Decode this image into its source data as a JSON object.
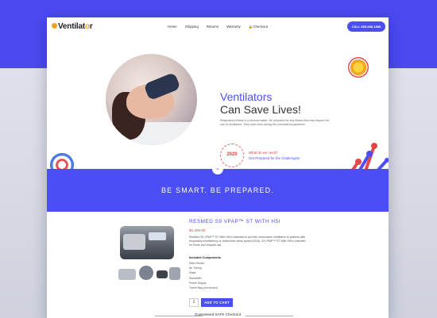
{
  "site": {
    "logo": {
      "prefix": "Ventilat",
      "o": "o",
      "suffix": "r"
    },
    "nav": [
      "Home",
      "Shipping",
      "Returns",
      "Warranty",
      "Checkout"
    ],
    "nav_checkout_icon": "lock-icon",
    "call_button": "CALL 855-688-1888",
    "hero": {
      "title1": "Ventilators",
      "title2": "Can Save Lives!",
      "text": "Respiratory illness is a serious matter. Be prepared for any illness that may require the use of ventilators. They save lives during the coronavirus pandemic.",
      "badge": "2020",
      "question": "What do we need?",
      "link": "Get Prepared for the Challenges!"
    },
    "band": {
      "text": "BE SMART.   BE PREPARED.",
      "chevron": "chevron-down-icon"
    },
    "product": {
      "title": "RESMED S9 VPAP™ ST WITH H5I",
      "price": "$2,400.00",
      "description": "ResMed S9 VPAP™ ST With H5i is intended to provide noninvasive ventilation to patients with respiratory insufficiency or obstructive sleep apnea (OSA). S9 VPAP™ ST With H5i is intended for home and hospital use.",
      "included_heading": "Included Components",
      "included": [
        "Main Device",
        "Air Tubing",
        "Mask",
        "Humidifier",
        "Power Supply",
        "Travel Bag (not shown)"
      ],
      "quantity": "1",
      "add_to_cart": "ADD TO CART",
      "safe_checkout": "Guaranteed SAFE Checkout"
    }
  },
  "colors": {
    "accent": "#4b4ef5",
    "red": "#e23d3d",
    "orange": "#f4a21c"
  }
}
